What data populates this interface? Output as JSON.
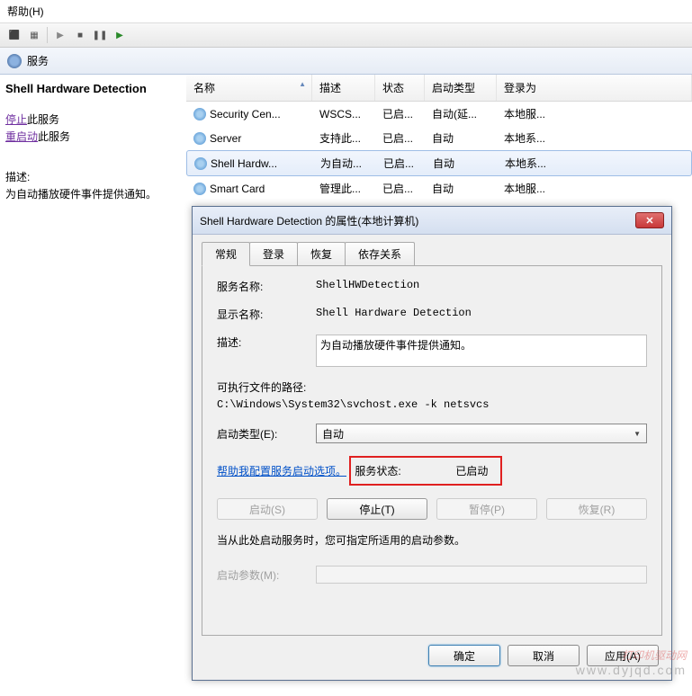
{
  "menu": {
    "help": "帮助(H)"
  },
  "subheader": {
    "title": "服务"
  },
  "left": {
    "service_name": "Shell Hardware Detection",
    "stop_link": "停止",
    "stop_suffix": "此服务",
    "restart_link": "重启动",
    "restart_suffix": "此服务",
    "desc_label": "描述:",
    "desc_text": "为自动播放硬件事件提供通知。"
  },
  "columns": {
    "name": "名称",
    "desc": "描述",
    "status": "状态",
    "startup": "启动类型",
    "logon": "登录为"
  },
  "rows": [
    {
      "name": "Security Cen...",
      "desc": "WSCS...",
      "status": "已启...",
      "startup": "自动(延...",
      "logon": "本地服..."
    },
    {
      "name": "Server",
      "desc": "支持此...",
      "status": "已启...",
      "startup": "自动",
      "logon": "本地系..."
    },
    {
      "name": "Shell Hardw...",
      "desc": "为自动...",
      "status": "已启...",
      "startup": "自动",
      "logon": "本地系..."
    },
    {
      "name": "Smart Card",
      "desc": "管理此...",
      "status": "已启...",
      "startup": "自动",
      "logon": "本地服..."
    }
  ],
  "dialog": {
    "title": "Shell Hardware Detection 的属性(本地计算机)",
    "tabs": {
      "general": "常规",
      "logon": "登录",
      "recovery": "恢复",
      "dependencies": "依存关系"
    },
    "fields": {
      "service_name_label": "服务名称:",
      "service_name_value": "ShellHWDetection",
      "display_name_label": "显示名称:",
      "display_name_value": "Shell Hardware Detection",
      "description_label": "描述:",
      "description_value": "为自动播放硬件事件提供通知。",
      "path_label": "可执行文件的路径:",
      "path_value": "C:\\Windows\\System32\\svchost.exe -k netsvcs",
      "startup_type_label": "启动类型(E):",
      "startup_type_value": "自动",
      "help_link": "帮助我配置服务启动选项。",
      "status_label": "服务状态:",
      "status_value": "已启动",
      "btn_start": "启动(S)",
      "btn_stop": "停止(T)",
      "btn_pause": "暂停(P)",
      "btn_resume": "恢复(R)",
      "hint": "当从此处启动服务时，您可指定所适用的启动参数。",
      "param_label": "启动参数(M):"
    },
    "footer": {
      "ok": "确定",
      "cancel": "取消",
      "apply": "应用(A)"
    }
  },
  "watermark": {
    "main": "打印机驱动网",
    "url": "www.dyjqd.com"
  }
}
